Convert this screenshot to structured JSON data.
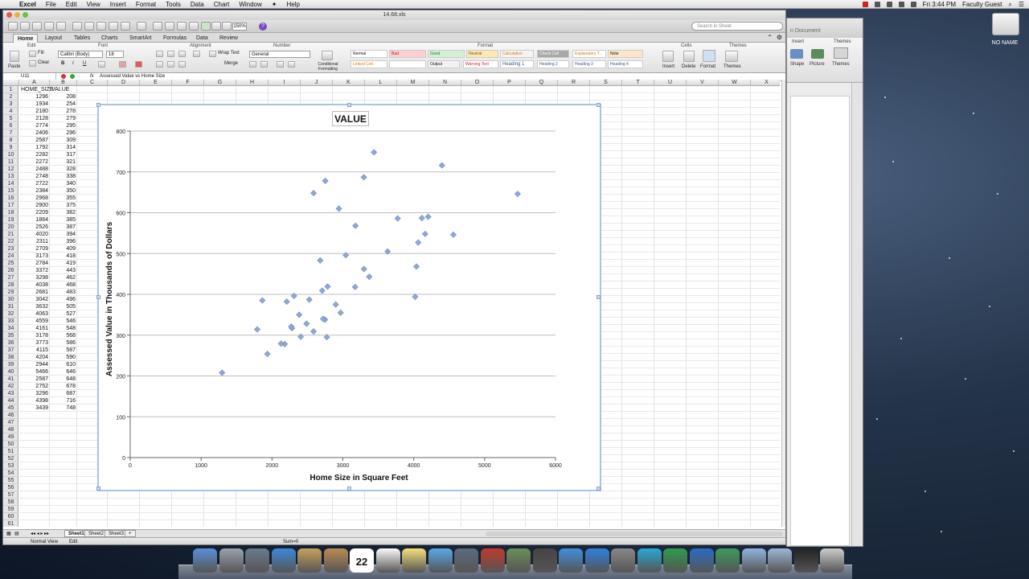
{
  "menubar": {
    "app": "Excel",
    "items": [
      "File",
      "Edit",
      "View",
      "Insert",
      "Format",
      "Tools",
      "Data",
      "Chart",
      "Window",
      "Help"
    ],
    "clock": "Fri 3:44 PM",
    "user": "Faculty Guest"
  },
  "desktop": {
    "drive_label": "NO NAME"
  },
  "word": {
    "title": "n Document",
    "ribbon_labels": [
      "Insert",
      "Themes",
      "Shape",
      "Picture",
      "Themes"
    ]
  },
  "excel": {
    "title": "14.68.xls",
    "zoom": "150%",
    "search_placeholder": "Search in Sheet",
    "tabs": [
      "Home",
      "Layout",
      "Tables",
      "Charts",
      "SmartArt",
      "Formulas",
      "Data",
      "Review"
    ],
    "ribbon": {
      "groups": [
        "Edit",
        "Font",
        "Alignment",
        "Number",
        "Format",
        "Cells",
        "Themes"
      ],
      "fill": "Fill",
      "clear": "Clear",
      "paste": "Paste",
      "font_name": "Calibri (Body)",
      "font_size": "18",
      "wrap_text": "Wrap Text",
      "merge": "Merge",
      "number_format": "General",
      "conditional": "Conditional Formatting",
      "styles": [
        "Normal",
        "Bad",
        "Good",
        "Neutral",
        "Calculation",
        "Check Cell",
        "Linked Cell",
        "Note",
        "Output",
        "Warning Text",
        "Heading 1",
        "Heading 2",
        "Heading 3",
        "Heading 4",
        "Explanatory T..."
      ],
      "cells_buttons": [
        "Insert",
        "Delete",
        "Format"
      ],
      "themes_button": "Themes"
    },
    "name_box": "U11",
    "formula": "Assessed Value vs Home Size",
    "columns": [
      "A",
      "B",
      "C",
      "D",
      "E",
      "F",
      "G",
      "H",
      "I",
      "J",
      "K",
      "L",
      "M",
      "N",
      "O",
      "P",
      "Q",
      "R",
      "S",
      "T",
      "U",
      "V",
      "W",
      "X"
    ],
    "headers": [
      "HOME_SIZE",
      "VALUE"
    ],
    "rows": [
      [
        1296,
        208
      ],
      [
        1934,
        254
      ],
      [
        2180,
        278
      ],
      [
        2128,
        279
      ],
      [
        2774,
        295
      ],
      [
        2406,
        296
      ],
      [
        2587,
        309
      ],
      [
        1792,
        314
      ],
      [
        2282,
        317
      ],
      [
        2272,
        321
      ],
      [
        2488,
        328
      ],
      [
        2748,
        338
      ],
      [
        2722,
        340
      ],
      [
        2384,
        350
      ],
      [
        2968,
        355
      ],
      [
        2900,
        375
      ],
      [
        2209,
        382
      ],
      [
        1864,
        385
      ],
      [
        2526,
        387
      ],
      [
        4020,
        394
      ],
      [
        2311,
        396
      ],
      [
        2709,
        409
      ],
      [
        3173,
        418
      ],
      [
        2784,
        419
      ],
      [
        3372,
        443
      ],
      [
        3298,
        462
      ],
      [
        4038,
        468
      ],
      [
        2681,
        483
      ],
      [
        3042,
        496
      ],
      [
        3632,
        505
      ],
      [
        4063,
        527
      ],
      [
        4559,
        546
      ],
      [
        4161,
        548
      ],
      [
        3178,
        568
      ],
      [
        3773,
        586
      ],
      [
        4115,
        587
      ],
      [
        4204,
        590
      ],
      [
        2944,
        610
      ],
      [
        5466,
        646
      ],
      [
        2587,
        648
      ],
      [
        2752,
        678
      ],
      [
        3296,
        687
      ],
      [
        4398,
        716
      ],
      [
        3439,
        748
      ]
    ],
    "row_count": 61,
    "sheets": [
      "Sheet1",
      "Sheet2",
      "Sheet3"
    ],
    "status": {
      "view": "Normal View",
      "mode": "Edit",
      "sum": "Sum=0"
    }
  },
  "chart_data": {
    "type": "scatter",
    "title": "VALUE",
    "xlabel": "Home Size in Square Feet",
    "ylabel": "Assessed Value in Thousands of Dollars",
    "xlim": [
      0,
      6000
    ],
    "ylim": [
      0,
      800
    ],
    "xticks": [
      0,
      1000,
      2000,
      3000,
      4000,
      5000,
      6000
    ],
    "yticks": [
      0,
      100,
      200,
      300,
      400,
      500,
      600,
      700,
      800
    ],
    "grid": "horizontal",
    "marker_color": "#8fa9d3",
    "x": [
      1296,
      1934,
      2180,
      2128,
      2774,
      2406,
      2587,
      1792,
      2282,
      2272,
      2488,
      2748,
      2722,
      2384,
      2968,
      2900,
      2209,
      1864,
      2526,
      4020,
      2311,
      2709,
      3173,
      2784,
      3372,
      3298,
      4038,
      2681,
      3042,
      3632,
      4063,
      4559,
      4161,
      3178,
      3773,
      4115,
      4204,
      2944,
      5466,
      2587,
      2752,
      3296,
      4398,
      3439
    ],
    "y": [
      208,
      254,
      278,
      279,
      295,
      296,
      309,
      314,
      317,
      321,
      328,
      338,
      340,
      350,
      355,
      375,
      382,
      385,
      387,
      394,
      396,
      409,
      418,
      419,
      443,
      462,
      468,
      483,
      496,
      505,
      527,
      546,
      548,
      568,
      586,
      587,
      590,
      610,
      646,
      648,
      678,
      687,
      716,
      748
    ]
  },
  "dock": {
    "items": [
      "finder-icon",
      "launchpad-icon",
      "mission-control-icon",
      "safari-icon",
      "preview-icon",
      "contacts-icon",
      "calendar-icon",
      "reminders-icon",
      "stickies-icon",
      "messages-icon",
      "facetime-icon",
      "photo-booth-icon",
      "iphoto-icon",
      "camera-icon",
      "itunes-icon",
      "app-store-icon",
      "system-preferences-icon",
      "skype-icon",
      "excel-icon",
      "word-icon",
      "numbers-icon",
      "downloads-icon",
      "documents-icon",
      "screen-icon",
      "trash-icon"
    ],
    "calendar_day": "22"
  }
}
